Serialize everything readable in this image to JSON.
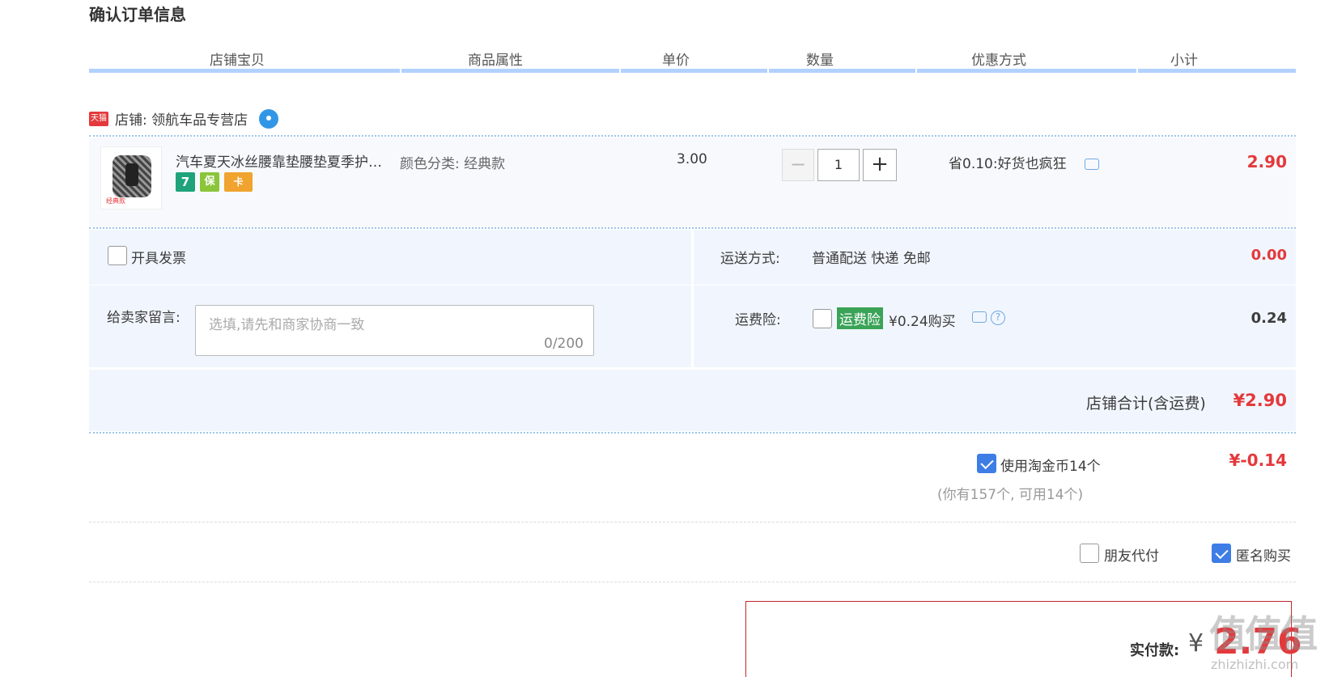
{
  "page_title": "确认订单信息",
  "columns": [
    "店铺宝贝",
    "商品属性",
    "单价",
    "数量",
    "优惠方式",
    "小计"
  ],
  "store": {
    "badge": "天猫",
    "label": "店铺: 领航车品专营店"
  },
  "item": {
    "title": "汽车夏天冰丝腰靠垫腰垫夏季护腰靠背透气车用腰托座椅靠垫",
    "thumb_caption": "经典款",
    "badges": [
      "7",
      "保",
      "卡"
    ],
    "attribute": "颜色分类: 经典款",
    "unit_price": "3.00",
    "quantity": "1",
    "minus": "−",
    "plus": "+",
    "discount": "省0.10:好货也疯狂",
    "subtotal": "2.90"
  },
  "invoice": {
    "label": "开具发票",
    "checked": false
  },
  "shipping": {
    "label": "运送方式:",
    "method": "普通配送 快递 免邮",
    "price": "0.00"
  },
  "note": {
    "label": "给卖家留言:",
    "placeholder": "选填,请先和商家协商一致",
    "count": "0/200"
  },
  "insurance": {
    "label": "运费险:",
    "tag": "运费险",
    "text": "¥0.24购买",
    "price": "0.24",
    "help": "?"
  },
  "store_total": {
    "label": "店铺合计(含运费)",
    "amount": "¥2.90"
  },
  "taojinbi": {
    "label": "使用淘金币14个",
    "checked": true,
    "note": "(你有157个, 可用14个)",
    "amount": "¥-0.14"
  },
  "friend_pay": {
    "label": "朋友代付",
    "checked": false
  },
  "anonymous": {
    "label": "匿名购买",
    "checked": true
  },
  "pay": {
    "label": "实付款:",
    "currency": "¥",
    "amount": "2.76"
  },
  "watermark": {
    "logo": "值值值",
    "url": "zhizhizhi.com"
  },
  "colors": {
    "price_red": "#e4393c",
    "header_blue": "#b2d1ff",
    "panel_bg": "#f1f6fe",
    "check_blue": "#3e7de6",
    "insurance_green": "#3aa357"
  }
}
